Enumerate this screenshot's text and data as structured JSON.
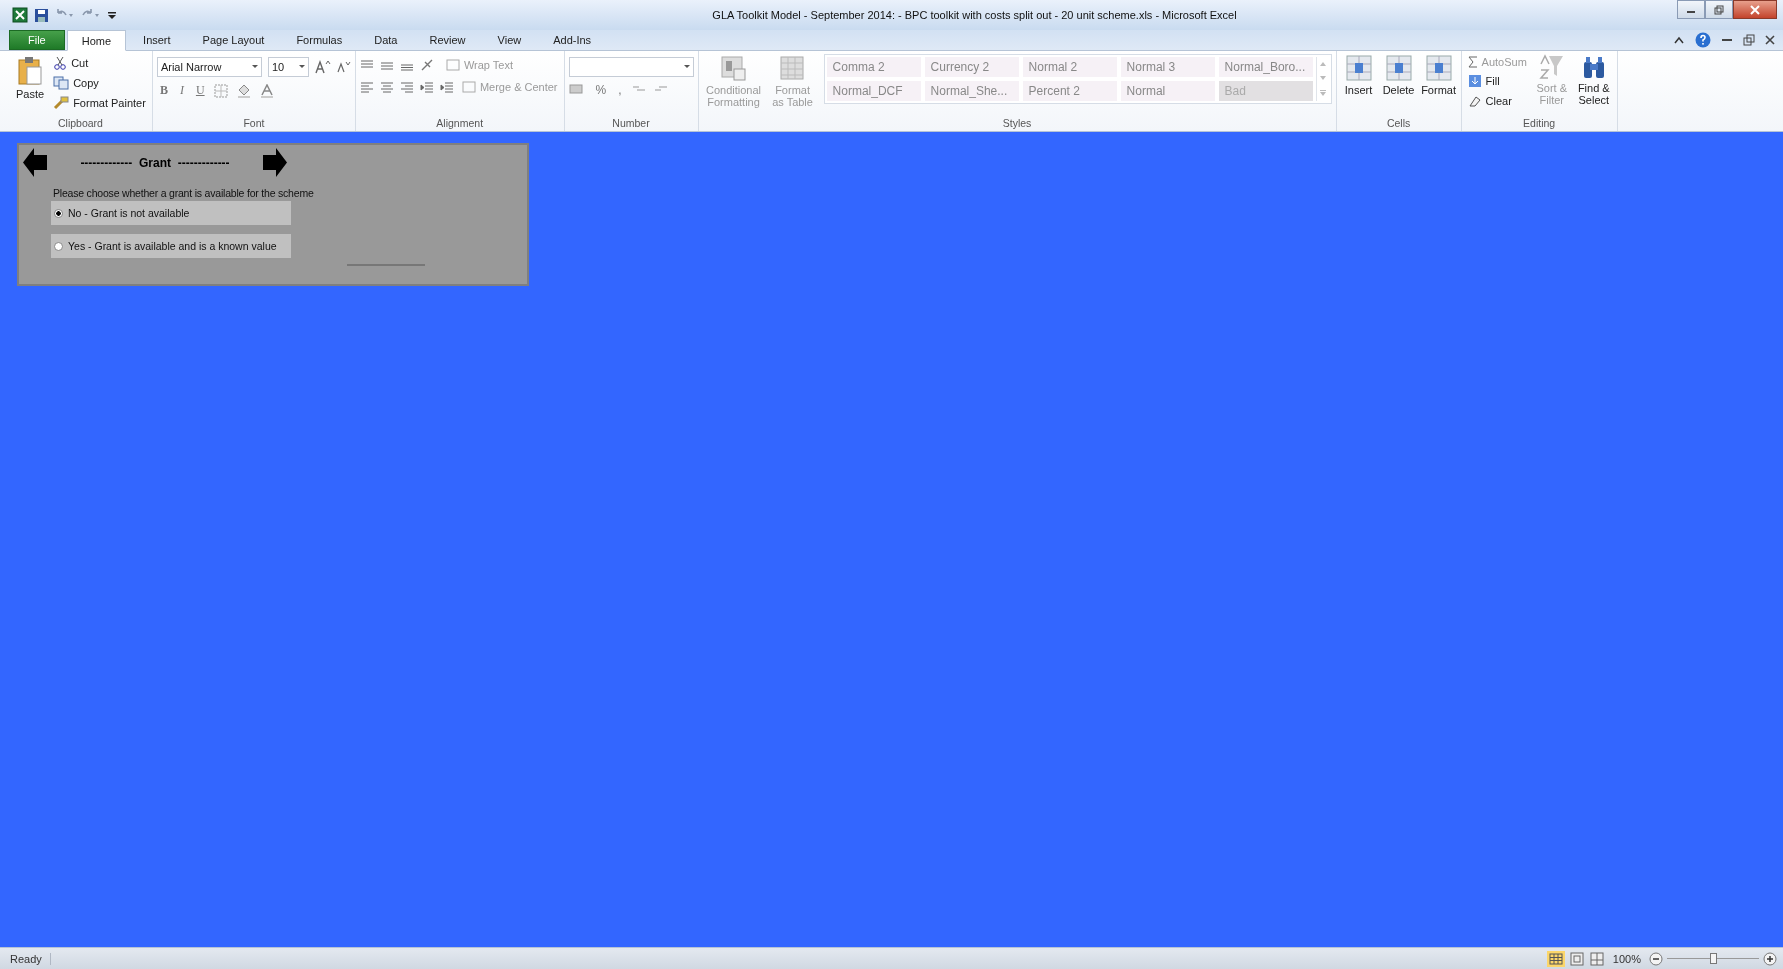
{
  "window": {
    "title": "GLA Toolkit Model - September 2014: - BPC toolkit with costs split out - 20 unit scheme.xls  -  Microsoft Excel"
  },
  "tabs": [
    {
      "label": "File",
      "selected": false,
      "kind": "file"
    },
    {
      "label": "Home",
      "selected": true,
      "kind": "tab"
    },
    {
      "label": "Insert",
      "selected": false,
      "kind": "tab"
    },
    {
      "label": "Page Layout",
      "selected": false,
      "kind": "tab"
    },
    {
      "label": "Formulas",
      "selected": false,
      "kind": "tab"
    },
    {
      "label": "Data",
      "selected": false,
      "kind": "tab"
    },
    {
      "label": "Review",
      "selected": false,
      "kind": "tab"
    },
    {
      "label": "View",
      "selected": false,
      "kind": "tab"
    },
    {
      "label": "Add-Ins",
      "selected": false,
      "kind": "tab"
    }
  ],
  "clipboard": {
    "label": "Clipboard",
    "paste": "Paste",
    "cut": "Cut",
    "copy": "Copy",
    "format_painter": "Format Painter"
  },
  "font": {
    "label": "Font",
    "name": "Arial Narrow",
    "size": "10",
    "bold": "B",
    "italic": "I",
    "underline": "U"
  },
  "alignment": {
    "label": "Alignment",
    "wrap_text": {
      "label": "Wrap Text",
      "disabled": true
    },
    "merge": {
      "label": "Merge & Center",
      "disabled": true
    }
  },
  "number": {
    "label": "Number",
    "percent": "%",
    "comma": ","
  },
  "styles": {
    "label": "Styles",
    "conditional": {
      "label": "Conditional Formatting",
      "disabled": true
    },
    "format_table": {
      "label": "Format as Table",
      "disabled": true
    },
    "items": [
      {
        "label": "Comma 2",
        "kind": "plain"
      },
      {
        "label": "Currency 2",
        "kind": "plain"
      },
      {
        "label": "Normal 2",
        "kind": "plain"
      },
      {
        "label": "Normal 3",
        "kind": "plain"
      },
      {
        "label": "Normal_Boro...",
        "kind": "plain"
      },
      {
        "label": "Normal_DCF",
        "kind": "plain"
      },
      {
        "label": "Normal_She...",
        "kind": "plain"
      },
      {
        "label": "Percent 2",
        "kind": "plain"
      },
      {
        "label": "Normal",
        "kind": "plain"
      },
      {
        "label": "Bad",
        "kind": "bad"
      }
    ]
  },
  "cells": {
    "label": "Cells",
    "buttons": [
      "Insert",
      "Delete",
      "Format"
    ]
  },
  "editing": {
    "label": "Editing",
    "autosum": {
      "label": "AutoSum",
      "disabled": true
    },
    "fill": {
      "label": "Fill",
      "disabled": false
    },
    "clear": {
      "label": "Clear",
      "disabled": false
    },
    "sort": {
      "label": "Sort & Filter",
      "disabled": true
    },
    "find": {
      "label": "Find & Select",
      "disabled": false
    }
  },
  "panel": {
    "title": "-------------  Grant  -------------",
    "prompt": "Please choose whether a grant is available for the scheme",
    "options": [
      {
        "label": "No - Grant is not available",
        "selected": true
      },
      {
        "label": "Yes - Grant is available and is a known value",
        "selected": false
      }
    ]
  },
  "status_bar": {
    "status": "Ready",
    "zoom": {
      "reading": "100%",
      "level": 0.5
    }
  }
}
